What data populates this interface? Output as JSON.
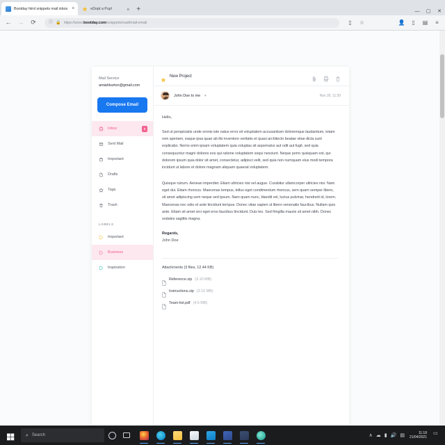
{
  "browser": {
    "tabs": [
      {
        "title": "Bootday html snippets mail inbox",
        "favicon": "page-favicon",
        "active": true
      },
      {
        "title": "eDopt a Pup!",
        "favicon": "star-favicon",
        "active": false
      }
    ],
    "new_tab_label": "+",
    "close_label": "×",
    "window_controls": {
      "minimize": "—",
      "maximize": "▢",
      "close": "✕"
    },
    "nav": {
      "back": "←",
      "forward": "→",
      "reload": "⟳"
    },
    "omnibox": {
      "info_icon": "info-icon",
      "lock_icon": "lock-icon",
      "url_prefix": "https://www.",
      "url_domain": "bootday.com",
      "url_path": "/snippets/read/mail-email"
    },
    "toolbar_right": [
      "split-screen-icon",
      "favorite-star-icon",
      "profile-icon",
      "collections-icon",
      "extensions-icon",
      "menu-icon"
    ]
  },
  "app": {
    "brand": {
      "title": "Mail Service",
      "email": "amiahburton@gmail.com"
    },
    "compose_label": "Compose Email",
    "nav_items": [
      {
        "label": "Inbox",
        "icon": "inbox-icon",
        "active": true,
        "badge": "2"
      },
      {
        "label": "Sent Mail",
        "icon": "sent-mail-icon",
        "active": false,
        "badge": ""
      },
      {
        "label": "Important",
        "icon": "important-icon",
        "active": false,
        "badge": ""
      },
      {
        "label": "Drafts",
        "icon": "drafts-icon",
        "active": false,
        "badge": ""
      },
      {
        "label": "Tags",
        "icon": "tags-star-icon",
        "active": false,
        "badge": ""
      },
      {
        "label": "Trash",
        "icon": "trash-icon",
        "active": false,
        "badge": ""
      }
    ],
    "labels_header": "LABELS",
    "labels": [
      {
        "label": "Important",
        "icon": "label-tag-icon",
        "color": "#f4c952",
        "active": false
      },
      {
        "label": "Business",
        "icon": "label-tag-icon",
        "color": "#ef7fa5",
        "active": true
      },
      {
        "label": "Inspiration",
        "icon": "label-tag-icon",
        "color": "#4fc4b8",
        "active": false
      }
    ]
  },
  "reader": {
    "star_icon": "star-icon",
    "subject": "New Project",
    "actions": [
      {
        "name": "attach-icon",
        "label": "Attach"
      },
      {
        "name": "print-icon",
        "label": "Print"
      },
      {
        "name": "delete-icon",
        "label": "Delete"
      }
    ],
    "sender": {
      "avatar": "avatar",
      "name": "John Doe to me",
      "chevron": "▾",
      "date": "Nov 20, 11:20"
    },
    "greeting": "Hello,",
    "paragraphs": [
      "Sed ut perspiciatis unde omnis iste natus error sit voluptatem accusantium doloremque laudantium, totam rem aperiam, eaque ipsa quae ab illo inventore veritatis et quasi architecto beatae vitae dicta sunt explicabo. Nemo enim ipsam voluptatem quia voluptas sit aspernatur aut odit aut fugit, sed quia consequuntur magni dolores eos qui ratione voluptatem sequi nesciunt. Neque porro quisquam est, qui dolorem ipsum quia dolor sit amet, consectetur, adipisci velit, sed quia non numquam eius modi tempora incidunt ut labore et dolore magnam aliquam quaerat voluptatem.",
      "Quisque rutrum. Aenean imperdiet. Etiam ultricies nisi vel augue. Curabitur ullamcorper ultricies nisi. Nam eget dui. Etiam rhoncus. Maecenas tempus, tellus eget condimentum rhoncus, sem quam semper libero, sit amet adipiscing sem neque sed ipsum. Nam quam nunc, blandit vel, luctus pulvinar, hendrerit id, lorem. Maecenas nec odio et ante tincidunt tempus. Donec vitae sapien ut libero venenatis faucibus. Nullam quis ante. Etiam sit amet orci eget eros faucibus tincidunt. Duis leo. Sed fringilla mauris sit amet nibh. Donec sodales sagittis magna."
    ],
    "signature": {
      "regards": "Regards,",
      "name": "John Doe"
    },
    "attachments": {
      "title": "Attachments (3 files, 12.44 KB)",
      "files": [
        {
          "name": "Reference.zip",
          "size": "(3.10 MB)",
          "icon": "file-icon"
        },
        {
          "name": "Instructions.zip",
          "size": "(3.15 MB)",
          "icon": "file-icon"
        },
        {
          "name": "Team-list.pdf",
          "size": "(4.5 MB)",
          "icon": "file-icon"
        }
      ]
    }
  },
  "taskbar": {
    "start_icon": "windows-start-icon",
    "search_placeholder": "Search",
    "search_icon": "search-icon",
    "cortana_icon": "cortana-icon",
    "taskview_icon": "task-view-icon",
    "apps": [
      {
        "name": "firefox-icon",
        "color": "#e55b2b",
        "running": true
      },
      {
        "name": "edge-icon",
        "color": "#1d9fd8",
        "running": true
      },
      {
        "name": "file-explorer-icon",
        "color": "#f5c242",
        "running": true
      },
      {
        "name": "store-icon",
        "color": "#e9eef3",
        "running": true
      },
      {
        "name": "mail-icon",
        "color": "#0f7fc4",
        "running": true
      },
      {
        "name": "photoshop-icon",
        "color": "#2f4a8c",
        "running": true
      },
      {
        "name": "illustrator-icon",
        "color": "#2b3a58",
        "running": true
      },
      {
        "name": "teams-icon",
        "color": "#4c61c4",
        "running": true
      }
    ],
    "tray": [
      "show-hidden-icons",
      "onedrive-icon",
      "network-icon",
      "volume-icon",
      "battery-icon"
    ],
    "clock": {
      "time": "11:18",
      "date": "21/04/2021"
    },
    "notification_icon": "action-center-icon"
  }
}
